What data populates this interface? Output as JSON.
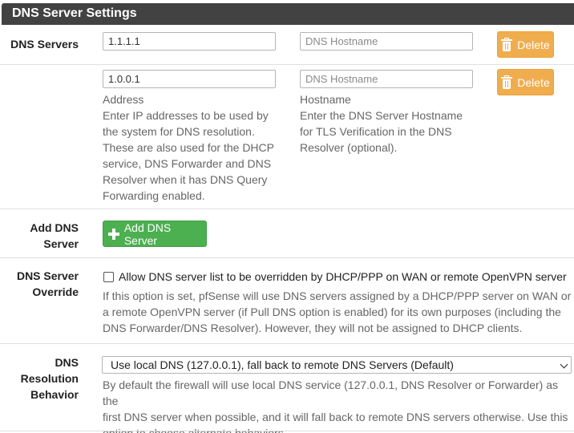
{
  "panel": {
    "title": "DNS Server Settings"
  },
  "dns_servers": {
    "label": "DNS Servers",
    "rows": [
      {
        "address": "1.1.1.1",
        "hostname_placeholder": "DNS Hostname",
        "delete_label": "Delete"
      },
      {
        "address": "1.0.0.1",
        "hostname_placeholder": "DNS Hostname",
        "delete_label": "Delete"
      }
    ],
    "address_title": "Address",
    "address_help": [
      "Enter IP addresses to be used by",
      "the system for DNS resolution.",
      "These are also used for the DHCP",
      "service, DNS Forwarder and DNS",
      "Resolver when it has DNS Query",
      "Forwarding enabled."
    ],
    "hostname_title": "Hostname",
    "hostname_help": [
      "Enter the DNS Server Hostname",
      "for TLS Verification in the DNS",
      "Resolver (optional)."
    ]
  },
  "add_dns": {
    "label_line1": "Add DNS",
    "label_line2": "Server",
    "button_label": "Add DNS Server"
  },
  "override": {
    "label_line1": "DNS Server",
    "label_line2": "Override",
    "checked": false,
    "checkbox_label": "Allow DNS server list to be overridden by DHCP/PPP on WAN or remote OpenVPN server",
    "help": [
      "If this option is set, pfSense will use DNS servers assigned by a DHCP/PPP server on WAN or",
      "a remote OpenVPN server (if Pull DNS option is enabled) for its own purposes (including the",
      "DNS Forwarder/DNS Resolver). However, they will not be assigned to DHCP clients."
    ]
  },
  "resolution": {
    "label_line1": "DNS",
    "label_line2": "Resolution",
    "label_line3": "Behavior",
    "selected": "Use local DNS (127.0.0.1), fall back to remote DNS Servers (Default)",
    "help": [
      "By default the firewall will use local DNS service (127.0.0.1, DNS Resolver or Forwarder) as the",
      "first DNS server when possible, and it will fall back to remote DNS servers otherwise. Use this",
      "option to choose alternate behaviors."
    ]
  },
  "colors": {
    "header": "#424242",
    "delete": "#f0ad4e",
    "add": "#4caf50"
  },
  "icons": {
    "delete": "trash-icon",
    "add": "plus-icon",
    "select": "chevron-down-icon"
  }
}
